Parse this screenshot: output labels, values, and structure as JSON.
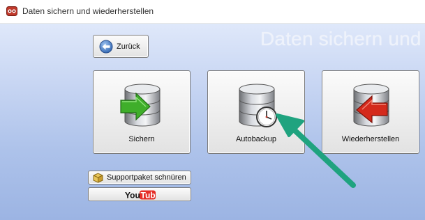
{
  "window": {
    "title": "Daten sichern und wiederherstellen"
  },
  "header": {
    "watermark": "Daten sichern und w"
  },
  "buttons": {
    "back": {
      "label": "Zurück",
      "icon": "back-arrow-icon"
    },
    "backup": {
      "label": "Sichern",
      "icon": "database-green-arrow-icon"
    },
    "autobackup": {
      "label": "Autobackup",
      "icon": "database-clock-icon"
    },
    "restore": {
      "label": "Wiederherstellen",
      "icon": "database-red-arrow-icon"
    },
    "support": {
      "label": "Supportpaket schnüren",
      "icon": "package-icon"
    },
    "youtube": {
      "logo_text_1": "You",
      "logo_text_2": "Tube"
    }
  },
  "colors": {
    "annotation_arrow": "#1fa37f",
    "background_top": "#dfe8fa",
    "background_bottom": "#9cb4e3",
    "youtube_red": "#e52d27"
  }
}
